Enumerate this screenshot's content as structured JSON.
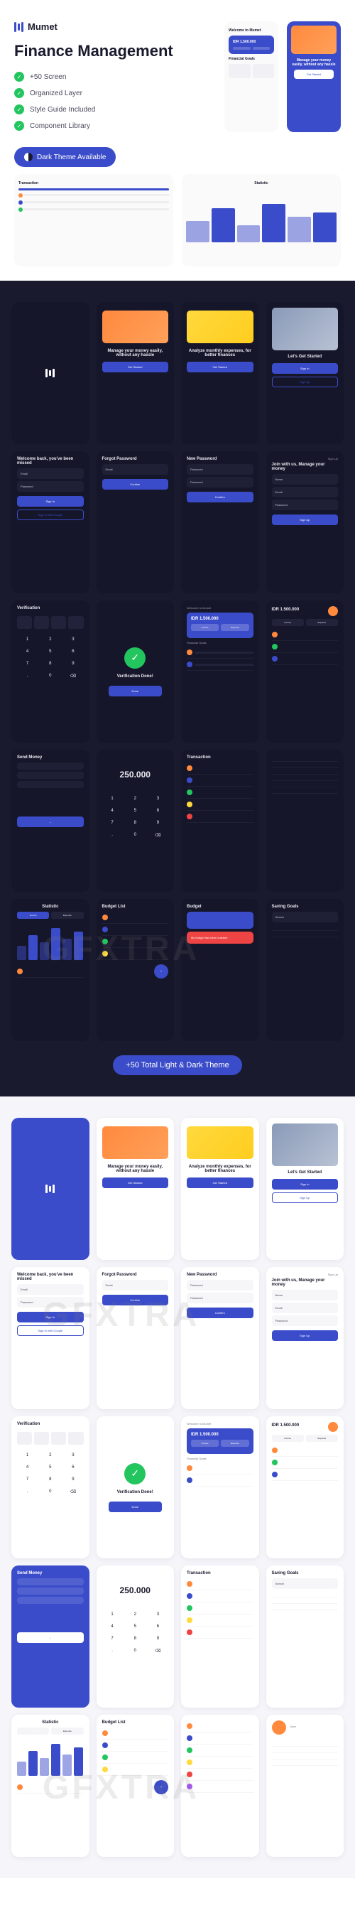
{
  "brand": "Mumet",
  "title": "Finance Management",
  "features": [
    "+50 Screen",
    "Organized Layer",
    "Style Guide Included",
    "Component Library"
  ],
  "dark_theme_btn": "Dark Theme Available",
  "hero_preview": {
    "balance": "IDR 1.500.000",
    "welcome": "Welcome to Mumet",
    "goals": "Financial Goals",
    "onboard": "Manage your money easily, without any hassle",
    "btn": "Get Started",
    "stats": "Statistic",
    "trans": "Transaction"
  },
  "pill": "+50 Total Light & Dark Theme",
  "screens": {
    "splash_logo": "",
    "onb1_title": "Manage your money easily, without any hassle",
    "onb2_title": "Analyze monthly expenses, for better finances",
    "start_title": "Let's Get Started",
    "welcome_back": "Welcome back, you've been missed",
    "signin": "Sign In",
    "forgot": "Forgot Password",
    "newpass": "New Password",
    "signup": "Sign Up",
    "signup_sub": "Join with us, Manage your money",
    "verify": "Verification",
    "verify_done": "Verification Done!",
    "home_welcome": "Welcome to Mumet",
    "balance": "IDR 1.500.000",
    "income_lbl": "Income",
    "expense_lbl": "Expense",
    "goals": "Financial Goals",
    "send_money": "Send Money",
    "amount": "250.000",
    "statistic": "Statistic",
    "budget": "Budget",
    "budget_list": "Budget List",
    "saving": "Saving Goals",
    "trans": "Transaction",
    "confirm": "Confirm",
    "done": "Done",
    "email": "Email",
    "password": "Password",
    "name": "Name",
    "google": "Sign in with Google",
    "budget_alert": "My budget has been cracked",
    "search": "Search"
  },
  "keypad": [
    "1",
    "2",
    "3",
    "4",
    "5",
    "6",
    "7",
    "8",
    "9",
    ".",
    "0",
    "⌫"
  ],
  "watermark": "GFXTRA"
}
